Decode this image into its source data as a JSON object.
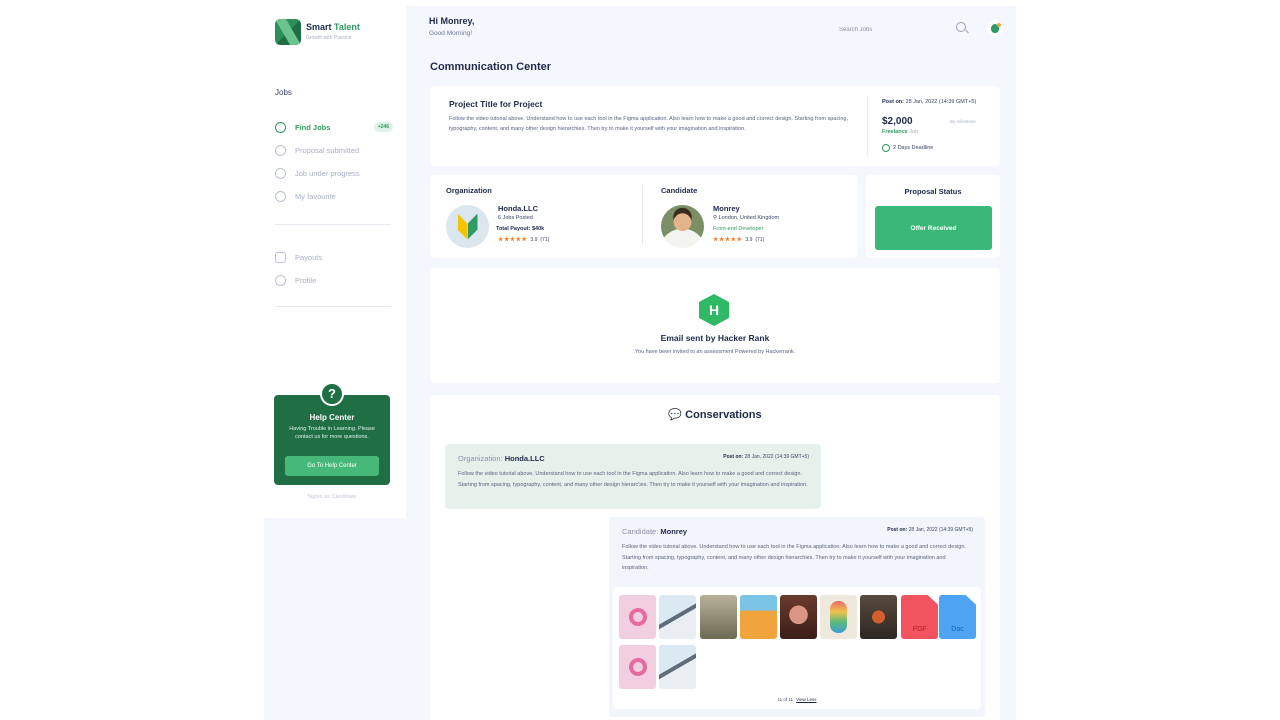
{
  "sidebar": {
    "brand_first": "Smart",
    "brand_second": "Talent",
    "tagline": "Growth with Passion",
    "section": "Jobs",
    "items": [
      {
        "label": "Find Jobs",
        "badge": "+246"
      },
      {
        "label": "Proposal submitted"
      },
      {
        "label": "Job under progress"
      },
      {
        "label": "My favourite"
      },
      {
        "label": "Payouts"
      },
      {
        "label": "Profile"
      }
    ],
    "help": {
      "icon_text": "?",
      "title": "Help Center",
      "text": "Having Trouble in Learning. Please contact us for more questions.",
      "button": "Go To Help Center"
    },
    "sign_as": "Signin as Candidate"
  },
  "header": {
    "greeting": "Hi Monrey,",
    "sub": "Good Morning!",
    "search_placeholder": "Search Jobs"
  },
  "page_title": "Communication Center",
  "project": {
    "title": "Project Title for Project",
    "description": "Follow the video tutorial above. Understand how to use each tool in the Figma application. Also learn how to make a good and correct design. Starting from spacing, typography, content, and many other design hierarchies. Then try to make it yourself with your imagination and inspiration.",
    "post_label": "Post on:",
    "post_date": "28 Jan, 2022 (14:39 GMT+5)",
    "price": "$2,000",
    "by": "By milestone",
    "type_strong": "Freelance",
    "type_rest": "Job",
    "deadline": "2 Days Deadline"
  },
  "organization": {
    "label": "Organization",
    "name": "Honda.LLC",
    "jobs_posted": "6 Jobs Posted",
    "payout": "Total Payout: $40k",
    "stars": "★★★★★",
    "rating": "3.9",
    "reviews": "(71)"
  },
  "candidate": {
    "label": "Candidate",
    "name": "Monrey",
    "location": "London, United Kingdom",
    "role": "Front-end Developer",
    "stars": "★★★★★",
    "rating": "3.9",
    "reviews": "(71)"
  },
  "proposal": {
    "title": "Proposal Status",
    "button": "Offer Received"
  },
  "hackerrank": {
    "logo_letter": "H",
    "title": "Email sent by Hacker Rank",
    "sub": "You have been invited to an assessment Powered by Hackerrank."
  },
  "conversations": {
    "title": "Conservations",
    "org_msg": {
      "from_label": "Organization:",
      "from_name": "Honda.LLC",
      "post_label": "Post on:",
      "post_date": "28 Jan, 2022 (14:39 GMT+5)",
      "body": "Follow the video tutorial above. Understand how to use each tool in the Figma application. Also learn how to make a good and correct design. Starting from spacing, typography, content, and many other design hierarc'ies. Then try to make it yourself with your imagination and inspiration."
    },
    "cand_msg": {
      "from_label": "Candidate:",
      "from_name": "Monrey",
      "post_label": "Post on:",
      "post_date": "28 Jan, 2022 (14:39 GMT+5)",
      "body": "Follow the video tutorial above. Understand how to use each tool in the Figma application. Also learn how to make a good and correct design. Starting from spacing, typography, content, and many other design hierarchies. Then try to make it yourself with your imagination and inspiration.",
      "attachments": {
        "pdf_label": "PDF",
        "doc_label": "Doc",
        "count": "11 of 11",
        "view_less": "View Less"
      }
    }
  },
  "colors": {
    "accent": "#2f9a63",
    "dark_green": "#1f6e44",
    "button_green": "#3ab877",
    "background": "#f4f7fd"
  }
}
